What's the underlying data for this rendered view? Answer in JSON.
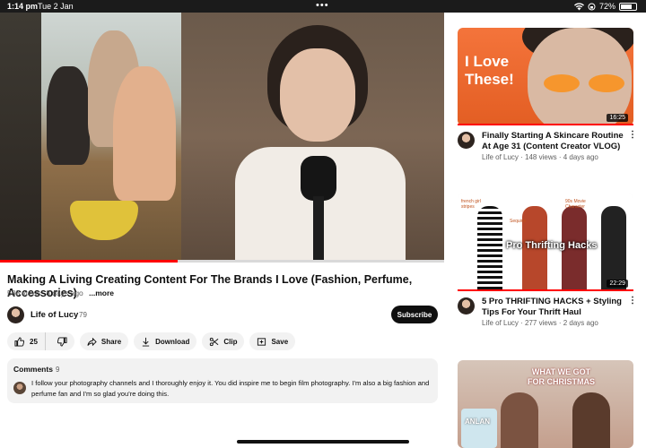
{
  "status_bar": {
    "time": "1:14 pm",
    "date": "Tue 2 Jan",
    "dots": "•••",
    "battery": "72%"
  },
  "player": {
    "progress_fraction": 0.4
  },
  "video": {
    "title": "Making A Living Creating Content For The Brands I Love (Fashion, Perfume, Accessories)",
    "views": "588 views",
    "age": "8 days ago",
    "more": "...more"
  },
  "channel": {
    "name": "Life of Lucy",
    "subscribers": "79",
    "subscribe_label": "Subscribe"
  },
  "actions": {
    "likes": "25",
    "share": "Share",
    "download": "Download",
    "clip": "Clip",
    "save": "Save"
  },
  "comments": {
    "heading": "Comments",
    "count": "9",
    "top_comment": "I follow your photography channels and I thoroughly enjoy it. You did inspire me to begin film photography. I'm also a big fashion and perfume fan and I'm so glad you're doing this."
  },
  "recommendations": [
    {
      "thumb_text_line1": "I Love",
      "thumb_text_line2": "These!",
      "duration": "16:25",
      "title": "Finally Starting A Skincare Routine At Age 31 (Content Creator VLOG)",
      "meta": "Life of Lucy · 148 views · 4 days ago",
      "more": "⋮"
    },
    {
      "thumb_headline": "Pro Thrifting Hacks",
      "thumb_label_a": "french girl stripes",
      "thumb_label_b": "Sequins",
      "thumb_label_c": "90s Movie Character",
      "duration": "22:29",
      "title": "5 Pro THRIFTING HACKS + Styling Tips For Your Thrift Haul",
      "meta": "Life of Lucy · 277 views · 2 days ago",
      "more": "⋮"
    },
    {
      "thumb_headline_line1": "WHAT WE GOT",
      "thumb_headline_line2": "FOR CHRISTMAS",
      "thumb_bag_text": "ANLAN"
    }
  ],
  "colors": {
    "accent_red": "#ff0000",
    "thumb_orange": "#f4743b",
    "text_primary": "#0f0f0f",
    "text_secondary": "#606060"
  }
}
